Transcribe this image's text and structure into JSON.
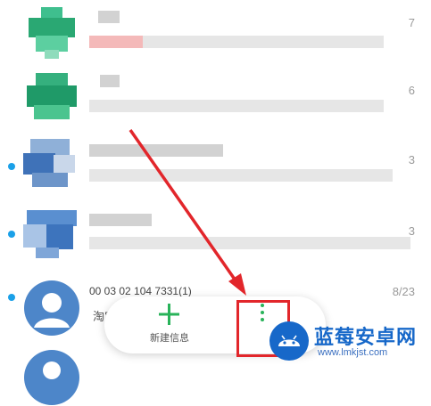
{
  "messages": [
    {
      "time_stub": "7",
      "unread": false
    },
    {
      "time_stub": "6",
      "unread": false
    },
    {
      "time_stub": "3",
      "unread": true
    },
    {
      "time_stub": "3",
      "unread": true
    },
    {
      "time_stub": "8/23",
      "unread": true,
      "sender_number": "00 03 02 104 7331(1)",
      "preview": "淘宝"
    }
  ],
  "fab": {
    "new_message_label": "新建信息",
    "more_icon": "more-vertical-icon",
    "new_icon": "plus-icon",
    "accent_color": "#29b35a"
  },
  "annotation": {
    "arrow_color": "#e2262b",
    "box_color": "#e2262b"
  },
  "watermark": {
    "brand": "蓝莓安卓网",
    "url": "www.lmkjst.com"
  }
}
